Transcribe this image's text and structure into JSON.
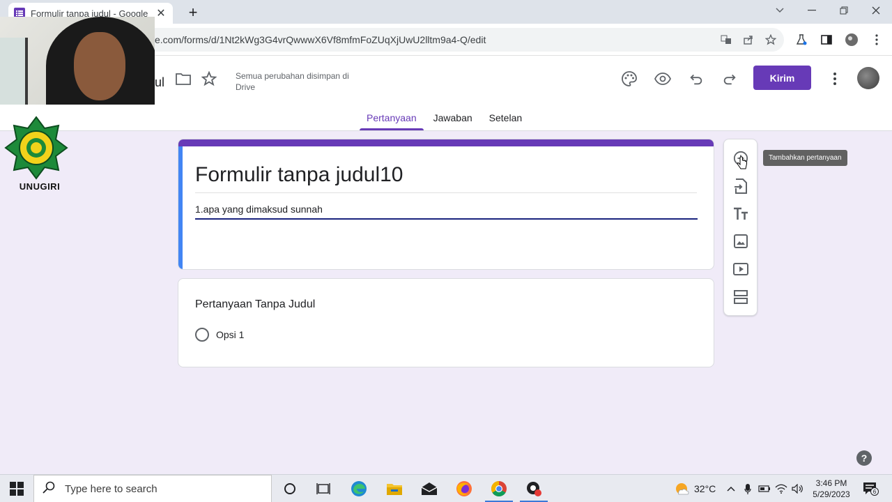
{
  "browser": {
    "tab_title": "Formulir tanpa judul - Google F",
    "url": "e.com/forms/d/1Nt2kWg3G4vrQwwwX6Vf8mfmFoZUqXjUwU2lltm9a4-Q/edit"
  },
  "header": {
    "title_partial": "ul",
    "save_status": "Semua perubahan disimpan di Drive",
    "send_label": "Kirim",
    "tabs": [
      {
        "label": "Pertanyaan",
        "active": true
      },
      {
        "label": "Jawaban",
        "active": false
      },
      {
        "label": "Setelan",
        "active": false
      }
    ]
  },
  "logo": {
    "text": "UNUGIRI"
  },
  "form": {
    "title": "Formulir tanpa judul10",
    "description": "1.apa yang dimaksud sunnah"
  },
  "question": {
    "title": "Pertanyaan Tanpa Judul",
    "option_label": "Opsi 1"
  },
  "sidetools": {
    "tooltip": "Tambahkan pertanyaan",
    "tools": [
      "add-question-icon",
      "import-questions-icon",
      "add-title-icon",
      "add-image-icon",
      "add-video-icon",
      "add-section-icon"
    ]
  },
  "help": {
    "label": "?"
  },
  "taskbar": {
    "search_placeholder": "Type here to search",
    "temperature": "32°C",
    "time": "3:46 PM",
    "date": "5/29/2023",
    "notification_count": "6"
  },
  "colors": {
    "accent": "#673ab7",
    "description_underline": "#1a237e",
    "title_card_side": "#4285f4",
    "background": "#f0ebf8"
  }
}
